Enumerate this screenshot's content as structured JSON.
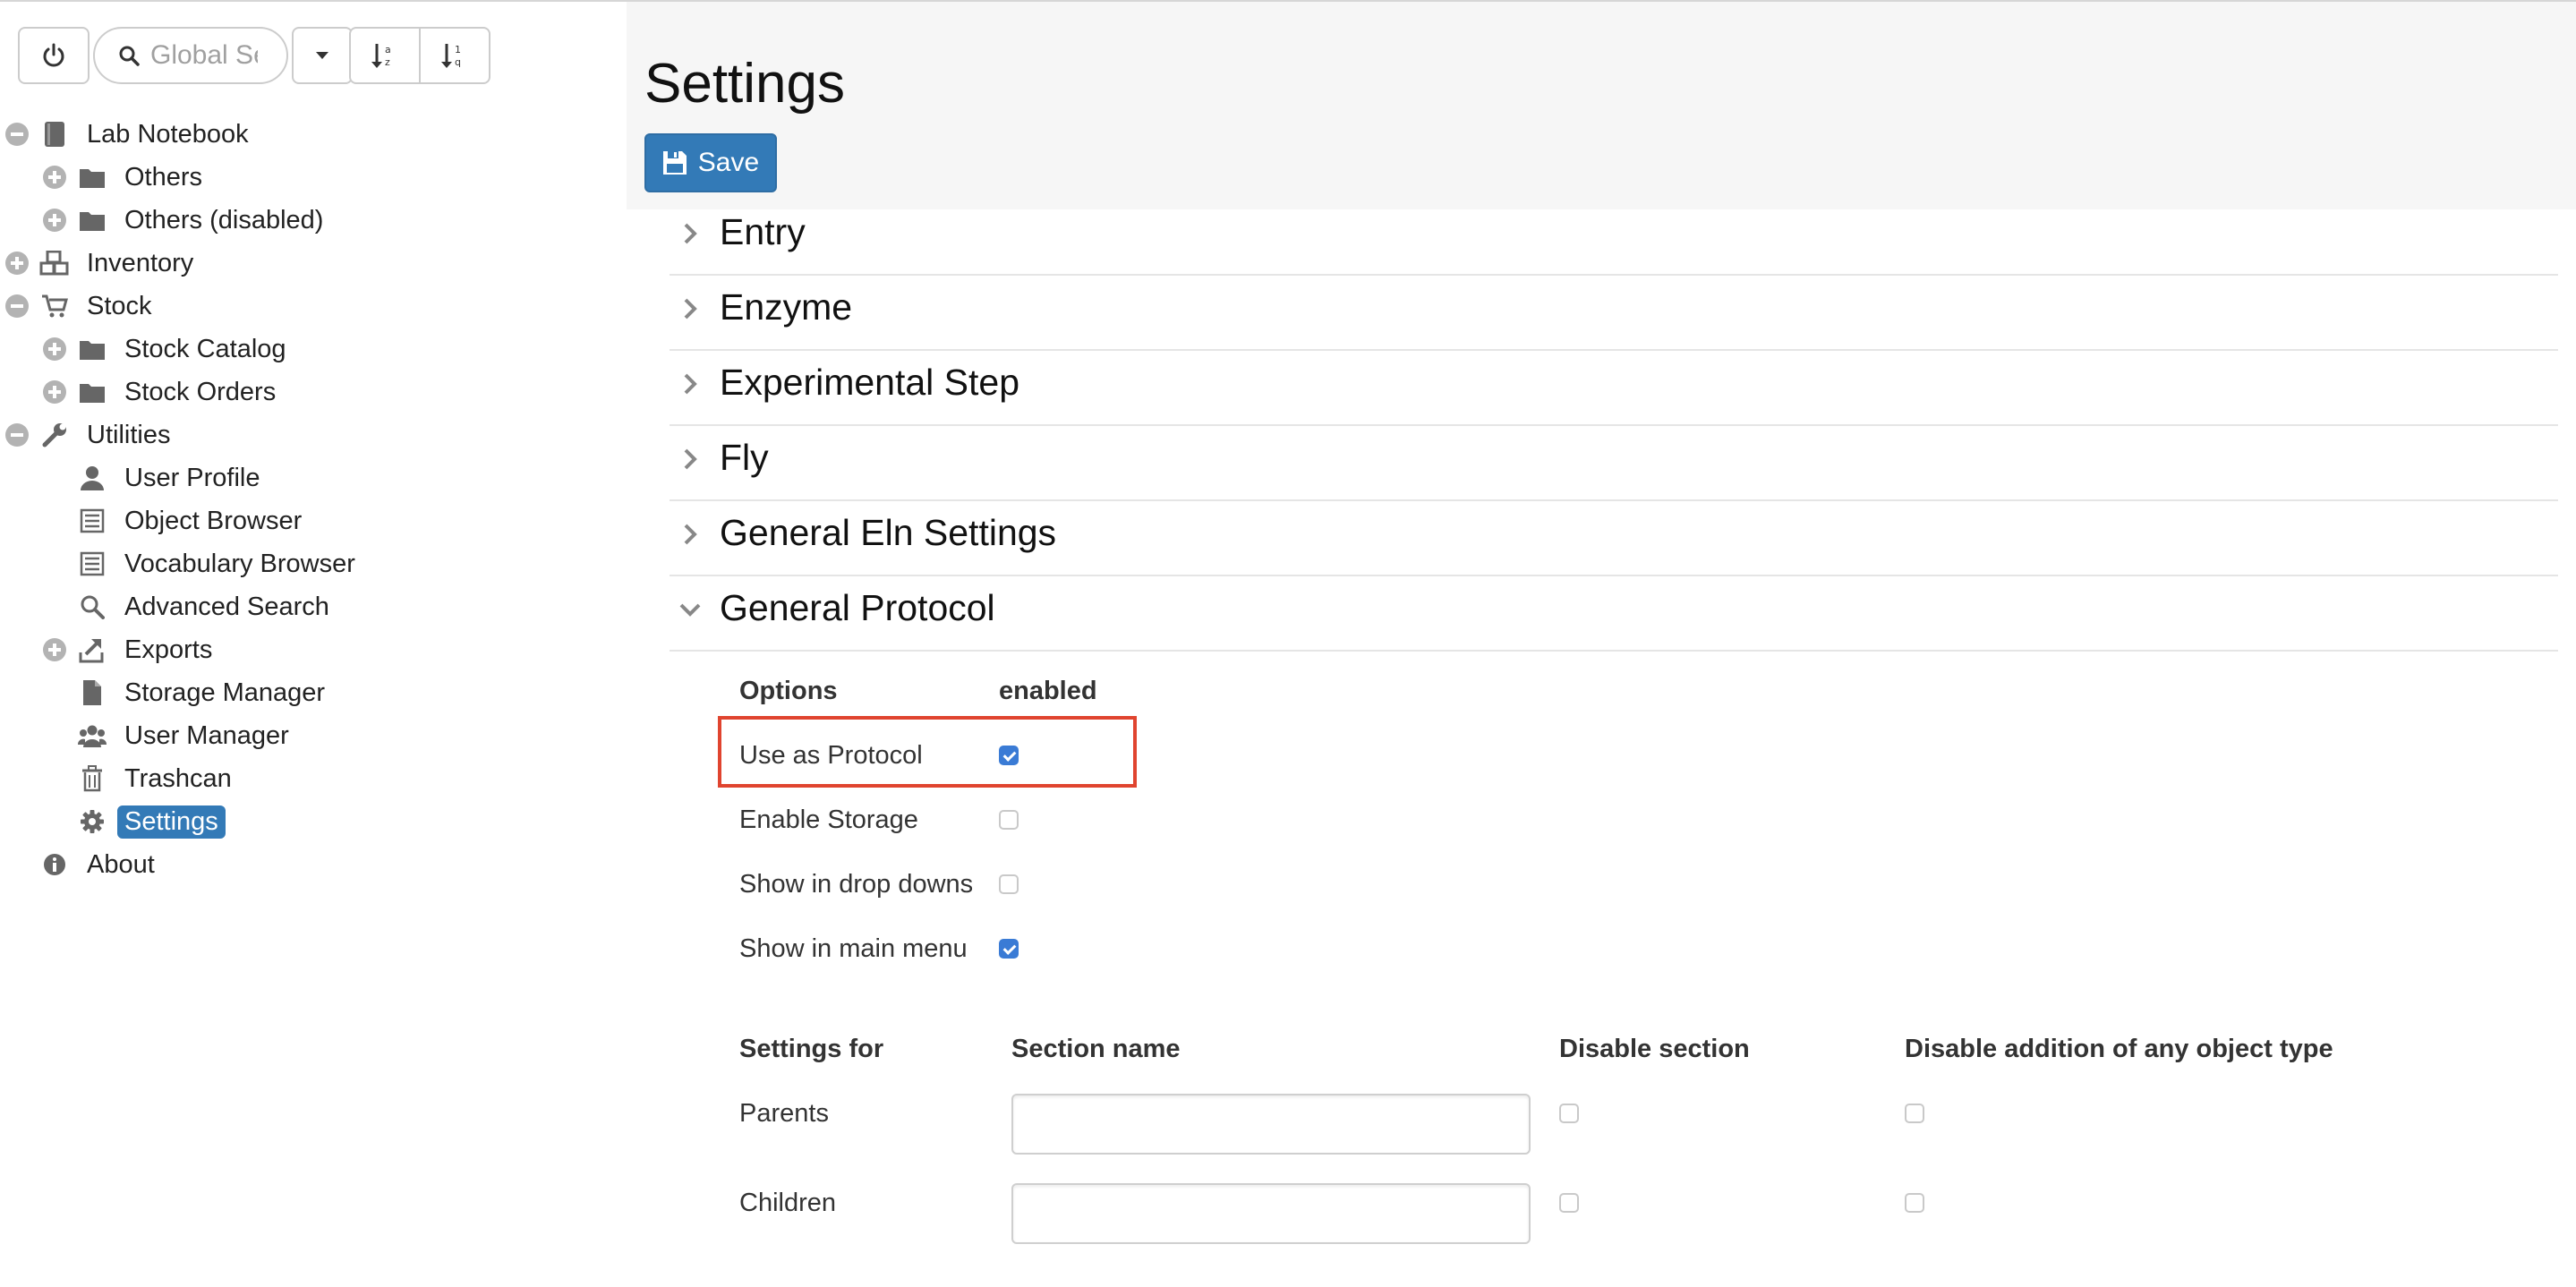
{
  "toolbar": {
    "search_placeholder": "Global Search"
  },
  "sidebar": {
    "items": [
      {
        "label": "Lab Notebook"
      },
      {
        "label": "Others"
      },
      {
        "label": "Others (disabled)"
      },
      {
        "label": "Inventory"
      },
      {
        "label": "Stock"
      },
      {
        "label": "Stock Catalog"
      },
      {
        "label": "Stock Orders"
      },
      {
        "label": "Utilities"
      },
      {
        "label": "User Profile"
      },
      {
        "label": "Object Browser"
      },
      {
        "label": "Vocabulary Browser"
      },
      {
        "label": "Advanced Search"
      },
      {
        "label": "Exports"
      },
      {
        "label": "Storage Manager"
      },
      {
        "label": "User Manager"
      },
      {
        "label": "Trashcan"
      },
      {
        "label": "Settings"
      },
      {
        "label": "About"
      }
    ],
    "selected": "Settings"
  },
  "main": {
    "title": "Settings",
    "save_label": "Save",
    "sections": [
      {
        "label": "Entry",
        "expanded": false
      },
      {
        "label": "Enzyme",
        "expanded": false
      },
      {
        "label": "Experimental Step",
        "expanded": false
      },
      {
        "label": "Fly",
        "expanded": false
      },
      {
        "label": "General Eln Settings",
        "expanded": false
      },
      {
        "label": "General Protocol",
        "expanded": true
      }
    ],
    "options": {
      "header_options": "Options",
      "header_enabled": "enabled",
      "rows": [
        {
          "label": "Use as Protocol",
          "checked": true
        },
        {
          "label": "Enable Storage",
          "checked": false
        },
        {
          "label": "Show in drop downs",
          "checked": false
        },
        {
          "label": "Show in main menu",
          "checked": true
        }
      ]
    },
    "settings_table": {
      "headers": [
        "Settings for",
        "Section name",
        "Disable section",
        "Disable addition of any object type"
      ],
      "rows": [
        {
          "label": "Parents",
          "section_name": "",
          "disable_section": false,
          "disable_addition": false
        },
        {
          "label": "Children",
          "section_name": "",
          "disable_section": false,
          "disable_addition": false
        }
      ]
    }
  },
  "colors": {
    "accent": "#337ab7",
    "checkbox_checked": "#3a7bd5",
    "highlight_box": "#e0442f",
    "header_band": "#f6f6f6"
  }
}
